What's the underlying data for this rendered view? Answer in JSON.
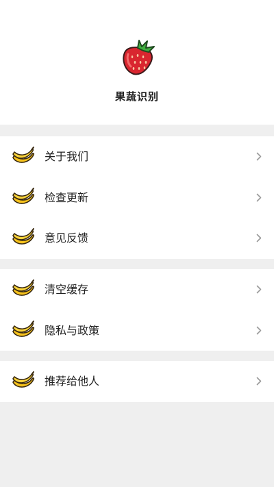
{
  "app": {
    "name": "果蔬识别",
    "logo_icon": "strawberry-icon"
  },
  "colors": {
    "background": "#efefef",
    "card": "#ffffff",
    "text": "#222222",
    "chevron": "#9a9a9a"
  },
  "menu": {
    "group1": [
      {
        "label": "关于我们",
        "icon": "banana-icon"
      },
      {
        "label": "检查更新",
        "icon": "banana-icon"
      },
      {
        "label": "意见反馈",
        "icon": "banana-icon"
      }
    ],
    "group2": [
      {
        "label": "清空缓存",
        "icon": "banana-icon"
      },
      {
        "label": "隐私与政策",
        "icon": "banana-icon"
      }
    ],
    "group3": [
      {
        "label": "推荐给他人",
        "icon": "banana-icon"
      }
    ]
  }
}
